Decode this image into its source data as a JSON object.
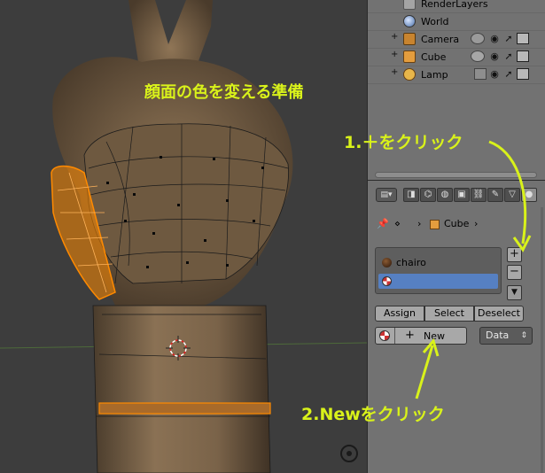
{
  "annotations": {
    "title": "顔面の色を変える準備",
    "step1": "1.＋をクリック",
    "step2": "2.Newをクリック"
  },
  "outliner": {
    "rows": [
      {
        "label": "RenderLayers",
        "icon": "render-layers-icon"
      },
      {
        "label": "World",
        "icon": "world-icon"
      },
      {
        "label": "Camera",
        "icon": "camera-icon"
      },
      {
        "label": "Cube",
        "icon": "mesh-icon"
      },
      {
        "label": "Lamp",
        "icon": "lamp-icon"
      }
    ]
  },
  "properties": {
    "breadcrumb": {
      "object": "Cube"
    },
    "material_slots": [
      {
        "name": "chairo",
        "selected": false
      },
      {
        "name": "",
        "selected": true
      }
    ],
    "slot_buttons": {
      "add": "+",
      "remove": "−",
      "menu": "▼"
    },
    "assign_row": {
      "assign": "Assign",
      "select": "Select",
      "deselect": "Deselect"
    },
    "new_button": {
      "label": "New",
      "plus": "+"
    },
    "link_select": {
      "value": "Data"
    }
  },
  "colors": {
    "annotation": "#d9f21a",
    "selection": "#5680c2",
    "mesh_selected": "#ff8a00"
  }
}
